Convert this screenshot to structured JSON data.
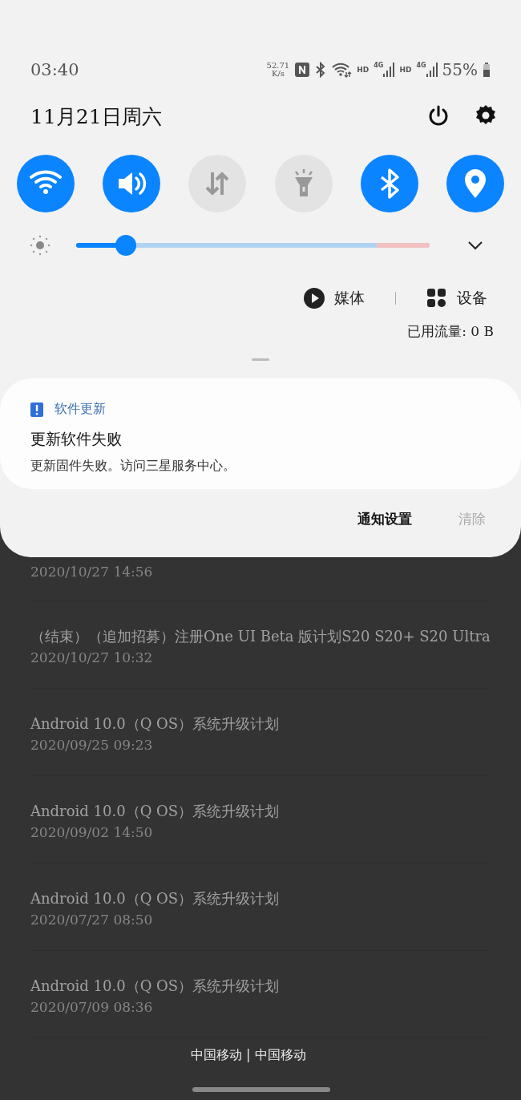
{
  "status_bar": {
    "time": "03:40",
    "net_speed": [
      "52.71",
      "K/s"
    ],
    "networks": [
      {
        "label": "HD",
        "type": "4G"
      },
      {
        "label": "HD",
        "type": "4G"
      }
    ],
    "battery": "55%"
  },
  "header": {
    "date": "11月21日周六"
  },
  "quick_tiles": [
    {
      "kind": "wifi",
      "on": true
    },
    {
      "kind": "sound",
      "on": true
    },
    {
      "kind": "data",
      "on": false
    },
    {
      "kind": "flashlight",
      "on": false
    },
    {
      "kind": "bluetooth",
      "on": true
    },
    {
      "kind": "location",
      "on": true
    }
  ],
  "brightness": {
    "level": 0.14
  },
  "media_devices": [
    {
      "kind": "media",
      "label": "媒体"
    },
    {
      "kind": "devices",
      "label": "设备"
    }
  ],
  "data_usage": "已用流量: 0 B",
  "notification": {
    "app": "软件更新",
    "title": "更新软件失败",
    "text": "更新固件失败。访问三星服务中心。",
    "actions": [
      {
        "label": "通知设置",
        "disabled": false
      },
      {
        "label": "清除",
        "disabled": true
      }
    ]
  },
  "background_list": [
    {
      "date": "2020/10/27 14:56"
    },
    {
      "title": "（结束）（追加招募）注册One UI Beta 版计划S20 S20+ S20 Ultra",
      "date": "2020/10/27 10:32"
    },
    {
      "title": "Android 10.0（Q OS）系统升级计划",
      "date": "2020/09/25 09:23"
    },
    {
      "title": "Android 10.0（Q OS）系统升级计划",
      "date": "2020/09/02 14:50"
    },
    {
      "title": "Android 10.0（Q OS）系统升级计划",
      "date": "2020/07/27 08:50"
    },
    {
      "title": "Android 10.0（Q OS）系统升级计划",
      "date": "2020/07/09 08:36"
    }
  ],
  "carrier": "中国移动 | 中国移动"
}
